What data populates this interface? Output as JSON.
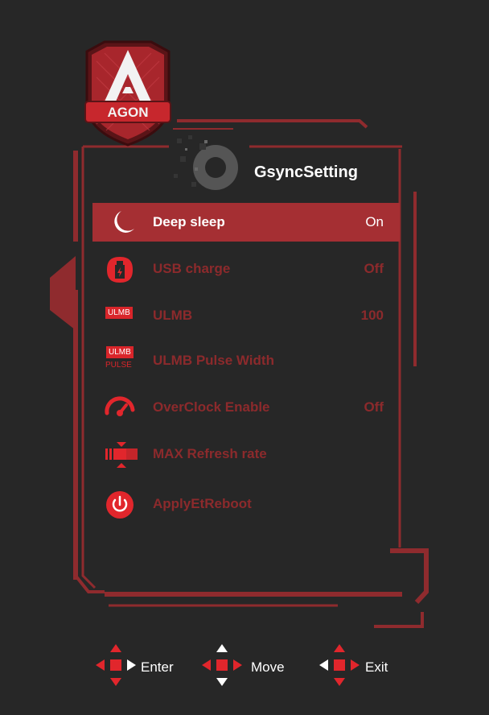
{
  "brand": {
    "logo_text": "AGON"
  },
  "title": "GsyncSetting",
  "menu": [
    {
      "label": "Deep sleep",
      "value": "On",
      "icon": "moon-icon",
      "selected": true
    },
    {
      "label": "USB charge",
      "value": "Off",
      "icon": "usb-charge-icon",
      "selected": false
    },
    {
      "label": "ULMB",
      "value": "100",
      "icon": "ulmb-icon",
      "icon_text": "ULMB",
      "selected": false
    },
    {
      "label": "ULMB Pulse Width",
      "value": "",
      "icon": "ulmb-pulse-icon",
      "icon_text": "ULMB",
      "icon_sub": "PULSE",
      "selected": false
    },
    {
      "label": "OverClock Enable",
      "value": "Off",
      "icon": "speedometer-icon",
      "selected": false
    },
    {
      "label": "MAX Refresh rate",
      "value": "",
      "icon": "refresh-rate-icon",
      "selected": false
    },
    {
      "label": "ApplyEtReboot",
      "value": "",
      "icon": "power-icon",
      "selected": false
    }
  ],
  "nav": {
    "enter": "Enter",
    "move": "Move",
    "exit": "Exit"
  },
  "colors": {
    "background": "#272727",
    "accent": "#a52f33",
    "bright_red": "#e1262c",
    "dim_text": "#8c2a2c"
  }
}
